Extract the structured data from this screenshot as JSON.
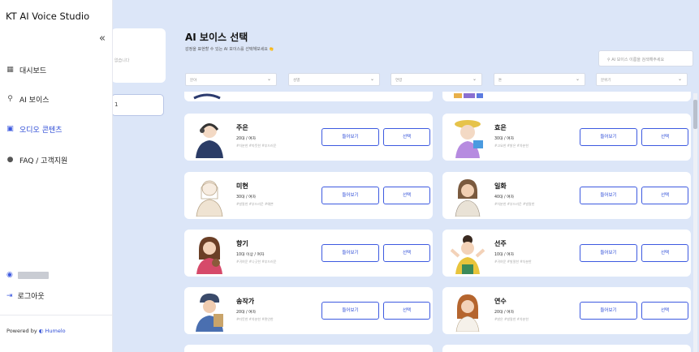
{
  "sidebar": {
    "brand": "KT AI Voice Studio",
    "collapse_icon": "«",
    "items": [
      {
        "label": "대시보드",
        "icon": "dashboard-icon"
      },
      {
        "label": "AI 보이스",
        "icon": "microphone-icon"
      },
      {
        "label": "오디오 콘텐츠",
        "icon": "audio-content-icon"
      },
      {
        "label": "FAQ / 고객지원",
        "icon": "help-icon"
      }
    ],
    "logout": "로그아웃",
    "powered_prefix": "Powered by",
    "powered_brand": "Humelo"
  },
  "ghost_panel": {
    "text1": "없습니다",
    "text2": "1"
  },
  "main": {
    "title": "AI 보이스 선택",
    "subtitle": "감정을 표현할 수 있는 AI 보이스를 선택해보세요 👏",
    "search_placeholder": "AI 보이스 이름을 검색해주세요",
    "filters": [
      "분야",
      "성별",
      "연령",
      "톤",
      "분위기"
    ]
  },
  "voice_cards": [
    {
      "name": "주은",
      "meta": "20대 / 여자",
      "tags": "#차분한 #따뜻한 #부드러운"
    },
    {
      "name": "효은",
      "meta": "30대 / 여자",
      "tags": "#고요한 #밝은 #차분한"
    },
    {
      "name": "미현",
      "meta": "30대 / 여자",
      "tags": "#발랄한 #부드러운 #예쁜"
    },
    {
      "name": "일화",
      "meta": "40대 / 여자",
      "tags": "#차분한 #부드러운 #발랄한"
    },
    {
      "name": "향기",
      "meta": "10대 이상 / 여자",
      "tags": "#귀여운 #나긋한 #부드러운"
    },
    {
      "name": "선주",
      "meta": "10대 / 여자",
      "tags": "#귀여운 #발랄한 #차분한"
    },
    {
      "name": "송작가",
      "meta": "20대 / 여자",
      "tags": "#따뜻한 #차분한 #편안한"
    },
    {
      "name": "연수",
      "meta": "20대 / 여자",
      "tags": "#밝은 #발랄한 #차분한"
    }
  ],
  "buttons": {
    "listen": "들어보기",
    "select": "선택"
  },
  "colors": {
    "accent": "#3d5ae0",
    "main_bg": "#dce6f8"
  }
}
